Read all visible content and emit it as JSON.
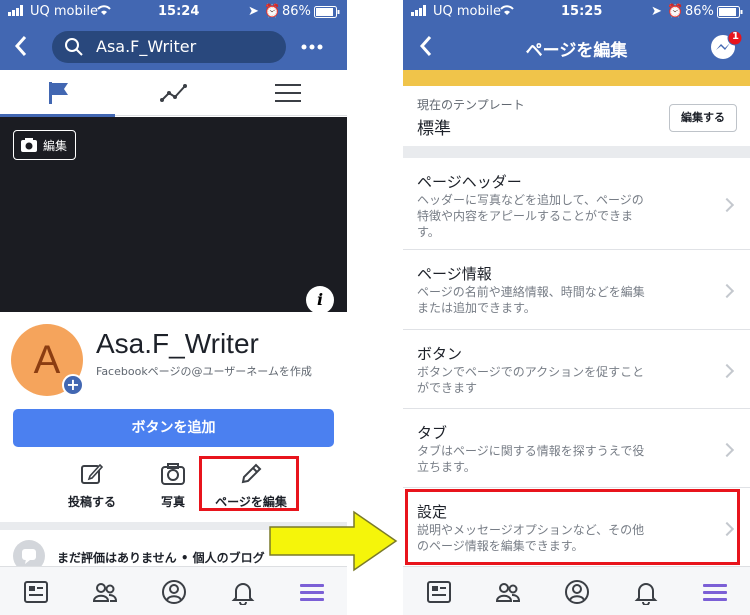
{
  "left": {
    "status": {
      "carrier": "UQ mobile",
      "time": "15:24",
      "battery": "86%"
    },
    "search_text": "Asa.F_Writer",
    "cover_edit_label": "編集",
    "avatar_letter": "A",
    "page_name": "Asa.F_Writer",
    "page_sub": "Facebookページの@ユーザーネームを作成",
    "add_button": "ボタンを追加",
    "actions": {
      "post": "投稿する",
      "photo": "写真",
      "edit_page": "ページを編集"
    },
    "review_text": "まだ評価はありません • 個人のブログ"
  },
  "right": {
    "status": {
      "carrier": "UQ mobile",
      "time": "15:25",
      "battery": "86%"
    },
    "title": "ページを編集",
    "messenger_badge": "1",
    "template": {
      "label": "現在のテンプレート",
      "value": "標準",
      "edit_button": "編集する"
    },
    "menu": [
      {
        "title": "ページヘッダー",
        "desc_lines": [
          "ヘッダーに写真などを追加して、ページの",
          "特徴や内容をアピールすることができま",
          "す。"
        ]
      },
      {
        "title": "ページ情報",
        "desc_lines": [
          "ページの名前や連絡情報、時間などを編集",
          "または追加できます。"
        ]
      },
      {
        "title": "ボタン",
        "desc_lines": [
          "ボタンでページでのアクションを促すこと",
          "ができます"
        ]
      },
      {
        "title": "タブ",
        "desc_lines": [
          "タブはページに関する情報を探すうえで役",
          "立ちます。"
        ]
      },
      {
        "title": "設定",
        "desc_lines": [
          "説明やメッセージオプションなど、その他",
          "のページ情報を編集できます。"
        ]
      }
    ]
  },
  "colors": {
    "facebook_blue": "#4267b2",
    "highlight_red": "#e8141c",
    "arrow_yellow": "#f5f50a"
  }
}
